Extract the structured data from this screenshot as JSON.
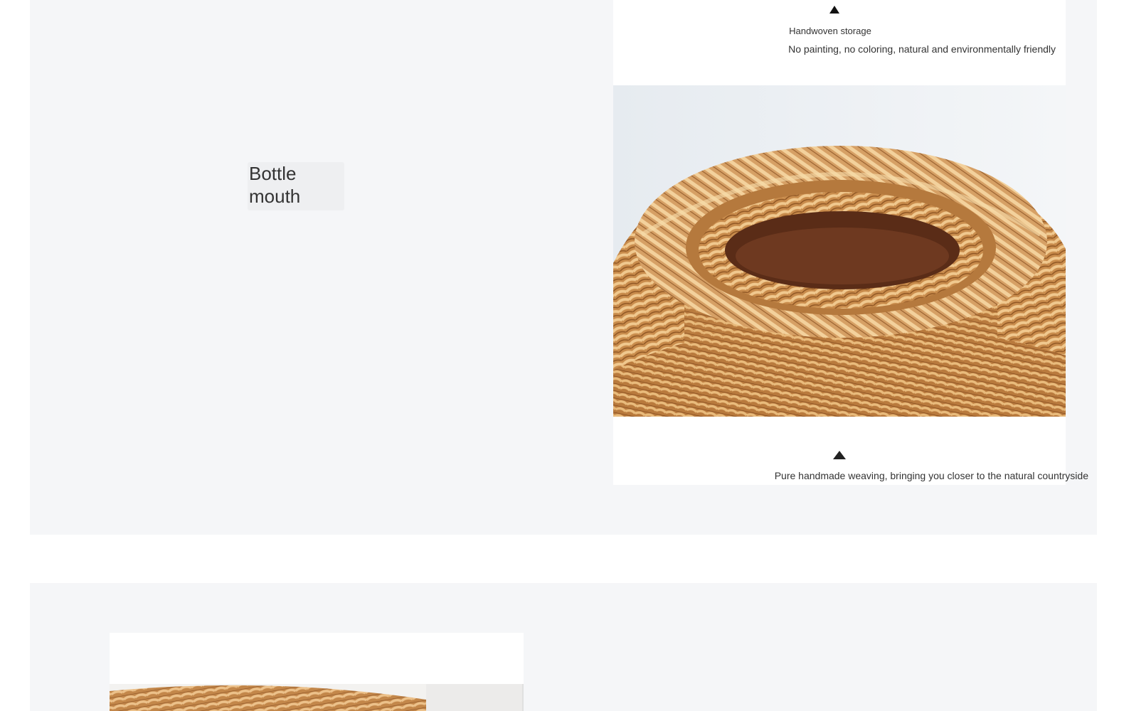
{
  "top_section": {
    "callout_label": "Bottle\nmouth",
    "product_card": {
      "small_title": "Handwoven storage",
      "caption_top": "No painting, no coloring, natural and environmentally friendly",
      "caption_bottom": "Pure handmade weaving, bringing you closer to the natural countryside",
      "photo_subject": "rattan basket bottle mouth close-up"
    }
  },
  "bottom_section": {
    "photo_subject": "woven rattan basket (partial)"
  },
  "colors": {
    "section_bg": "#f5f6f8",
    "card_bg": "#ffffff",
    "rattan_light": "#e3b77a",
    "rattan_dark": "#a3652d",
    "text": "#333333"
  },
  "icons": [
    "triangle-up-icon",
    "triangle-up-icon"
  ]
}
